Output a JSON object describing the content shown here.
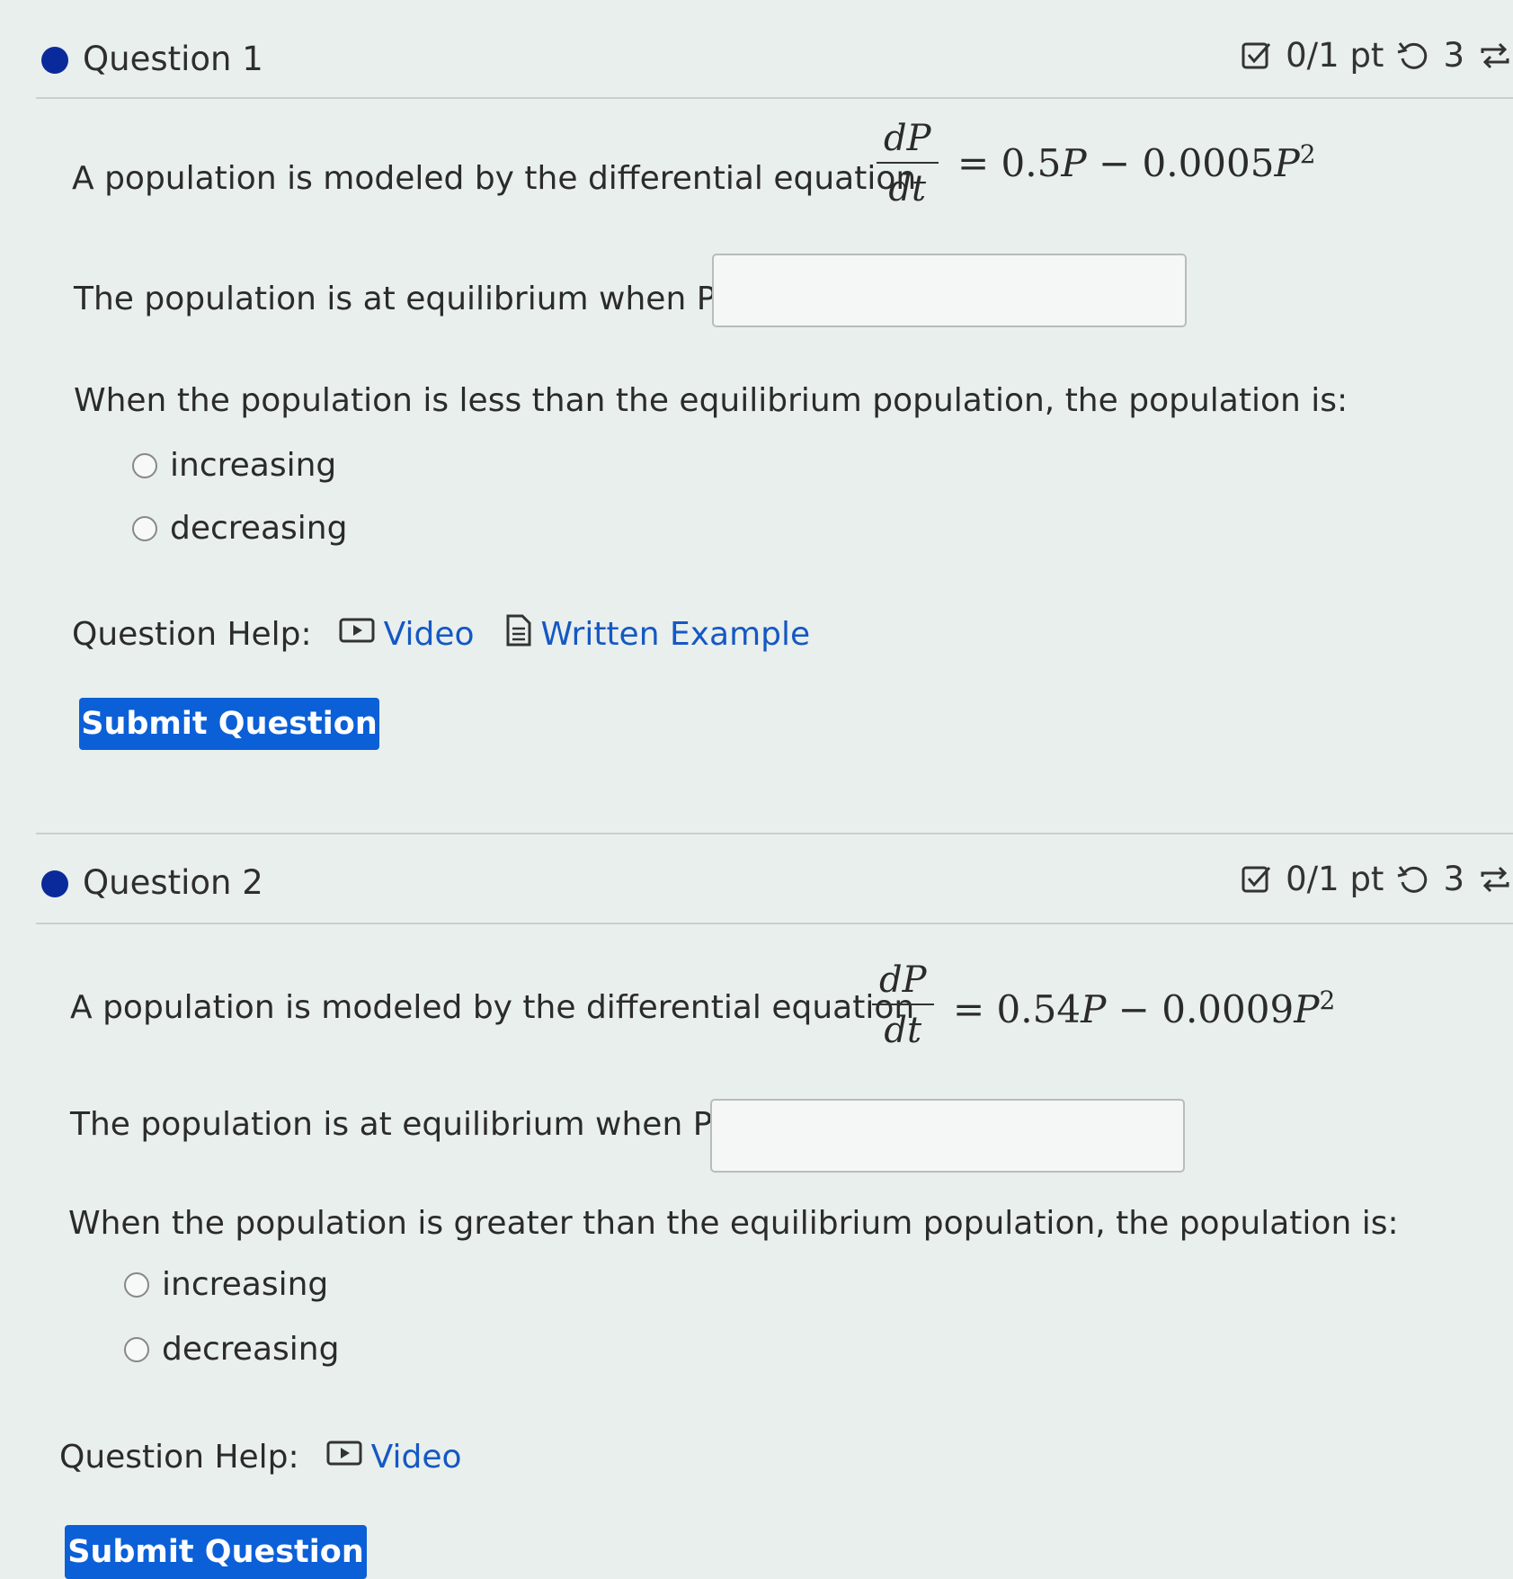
{
  "questions": [
    {
      "title": "Question 1",
      "points": "0/1 pt",
      "attempts": "3",
      "equation_prefix": "A population is modeled by the differential equation",
      "deriv_num": "dP",
      "deriv_den": "dt",
      "equation_rhs": {
        "eq": "= ",
        "c1": "0.5",
        "v1": "P",
        "minus": " − ",
        "c2": "0.0005",
        "v2": "P",
        "exp": "2"
      },
      "equilibrium_prompt": "The population is at equilibrium when P =",
      "answer_value": "",
      "behavior_prompt": "When the population is less than the equilibrium population, the population is:",
      "options": [
        "increasing",
        "decreasing"
      ],
      "help_label": "Question Help:",
      "help_links": [
        "Video",
        "Written Example"
      ],
      "submit_label": "Submit Question"
    },
    {
      "title": "Question 2",
      "points": "0/1 pt",
      "attempts": "3",
      "equation_prefix": "A population is modeled by the differential equation",
      "deriv_num": "dP",
      "deriv_den": "dt",
      "equation_rhs": {
        "eq": "= ",
        "c1": "0.54",
        "v1": "P",
        "minus": " − ",
        "c2": "0.0009",
        "v2": "P",
        "exp": "2"
      },
      "equilibrium_prompt": "The population is at equilibrium when P =",
      "answer_value": "",
      "behavior_prompt": "When the population is greater than the equilibrium population, the population is:",
      "options": [
        "increasing",
        "decreasing"
      ],
      "help_label": "Question Help:",
      "help_links": [
        "Video"
      ],
      "submit_label": "Submit Question"
    }
  ]
}
